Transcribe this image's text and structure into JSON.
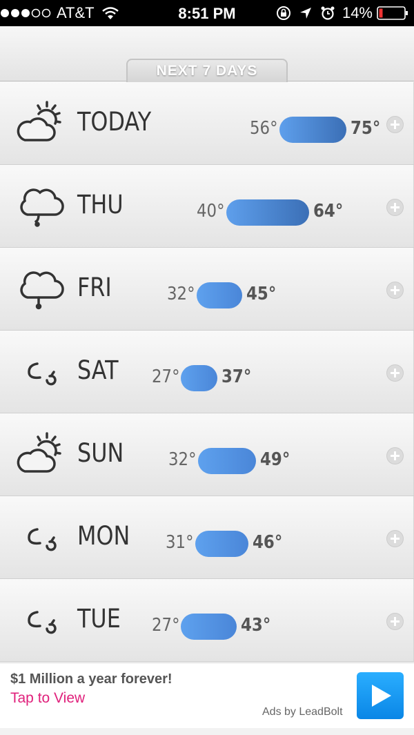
{
  "status_bar": {
    "carrier": "AT&T",
    "time": "8:51 PM",
    "battery_percent": "14%",
    "icons": [
      "signal-dots-icon",
      "wifi-icon",
      "rotation-lock-icon",
      "location-arrow-icon",
      "alarm-icon",
      "battery-icon"
    ]
  },
  "header": {
    "tab_label": "NEXT 7 DAYS"
  },
  "forecast": {
    "days": [
      {
        "day": "TODAY",
        "icon": "partly-cloudy-icon",
        "low": "56°",
        "high": "75°"
      },
      {
        "day": "THU",
        "icon": "cloud-icon",
        "low": "40°",
        "high": "64°"
      },
      {
        "day": "FRI",
        "icon": "cloud-drizzle-icon",
        "low": "32°",
        "high": "45°"
      },
      {
        "day": "SAT",
        "icon": "wind-icon",
        "low": "27°",
        "high": "37°"
      },
      {
        "day": "SUN",
        "icon": "partly-cloudy-icon",
        "low": "32°",
        "high": "49°"
      },
      {
        "day": "MON",
        "icon": "wind-icon",
        "low": "31°",
        "high": "46°"
      },
      {
        "day": "TUE",
        "icon": "wind-icon",
        "low": "27°",
        "high": "43°"
      }
    ],
    "expand_icon": "plus-circle-icon"
  },
  "ad": {
    "title": "$1 Million a year forever!",
    "cta": "Tap to View",
    "credit": "Ads by LeadBolt",
    "play_icon": "play-icon",
    "cta_color": "#e0207b"
  },
  "colors": {
    "bar_light": "#5ea1ee",
    "bar_dark": "#3b6fb6"
  }
}
